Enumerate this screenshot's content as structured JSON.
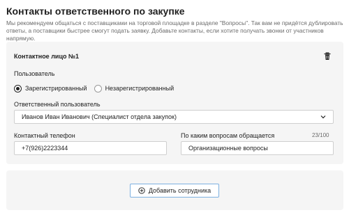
{
  "header": {
    "title": "Контакты ответственного по закупке",
    "description": "Мы рекомендуем общаться с поставщиками на торговой площадке в разделе \"Вопросы\". Так вам не придётся дублировать ответы, а поставщики быстрее смогут подать заявку. Добавьте контакты, если хотите получать звонки от участников напрямую."
  },
  "contact": {
    "title": "Контактное лицо №1",
    "user_label": "Пользователь",
    "radio_options": [
      {
        "label": "Зарегистрированный",
        "checked": true
      },
      {
        "label": "Незарегистрированный",
        "checked": false
      }
    ],
    "responsible_label": "Ответственный пользователь",
    "responsible_value": "Иванов Иван Иванович (Специалист отдела закупок)",
    "phone_label": "Контактный телефон",
    "phone_value": "+7(926)2223344",
    "questions_label": "По каким вопросам обращается",
    "questions_counter": "23/100",
    "questions_value": "Организационные вопросы"
  },
  "actions": {
    "add_employee": "Добавить сотрудника"
  },
  "icons": {
    "delete": "trash-icon",
    "dropdown": "chevron-down-icon",
    "add": "plus-circle-icon"
  },
  "colors": {
    "card_background": "#f5f5f5",
    "button_border": "#7db0e0"
  }
}
